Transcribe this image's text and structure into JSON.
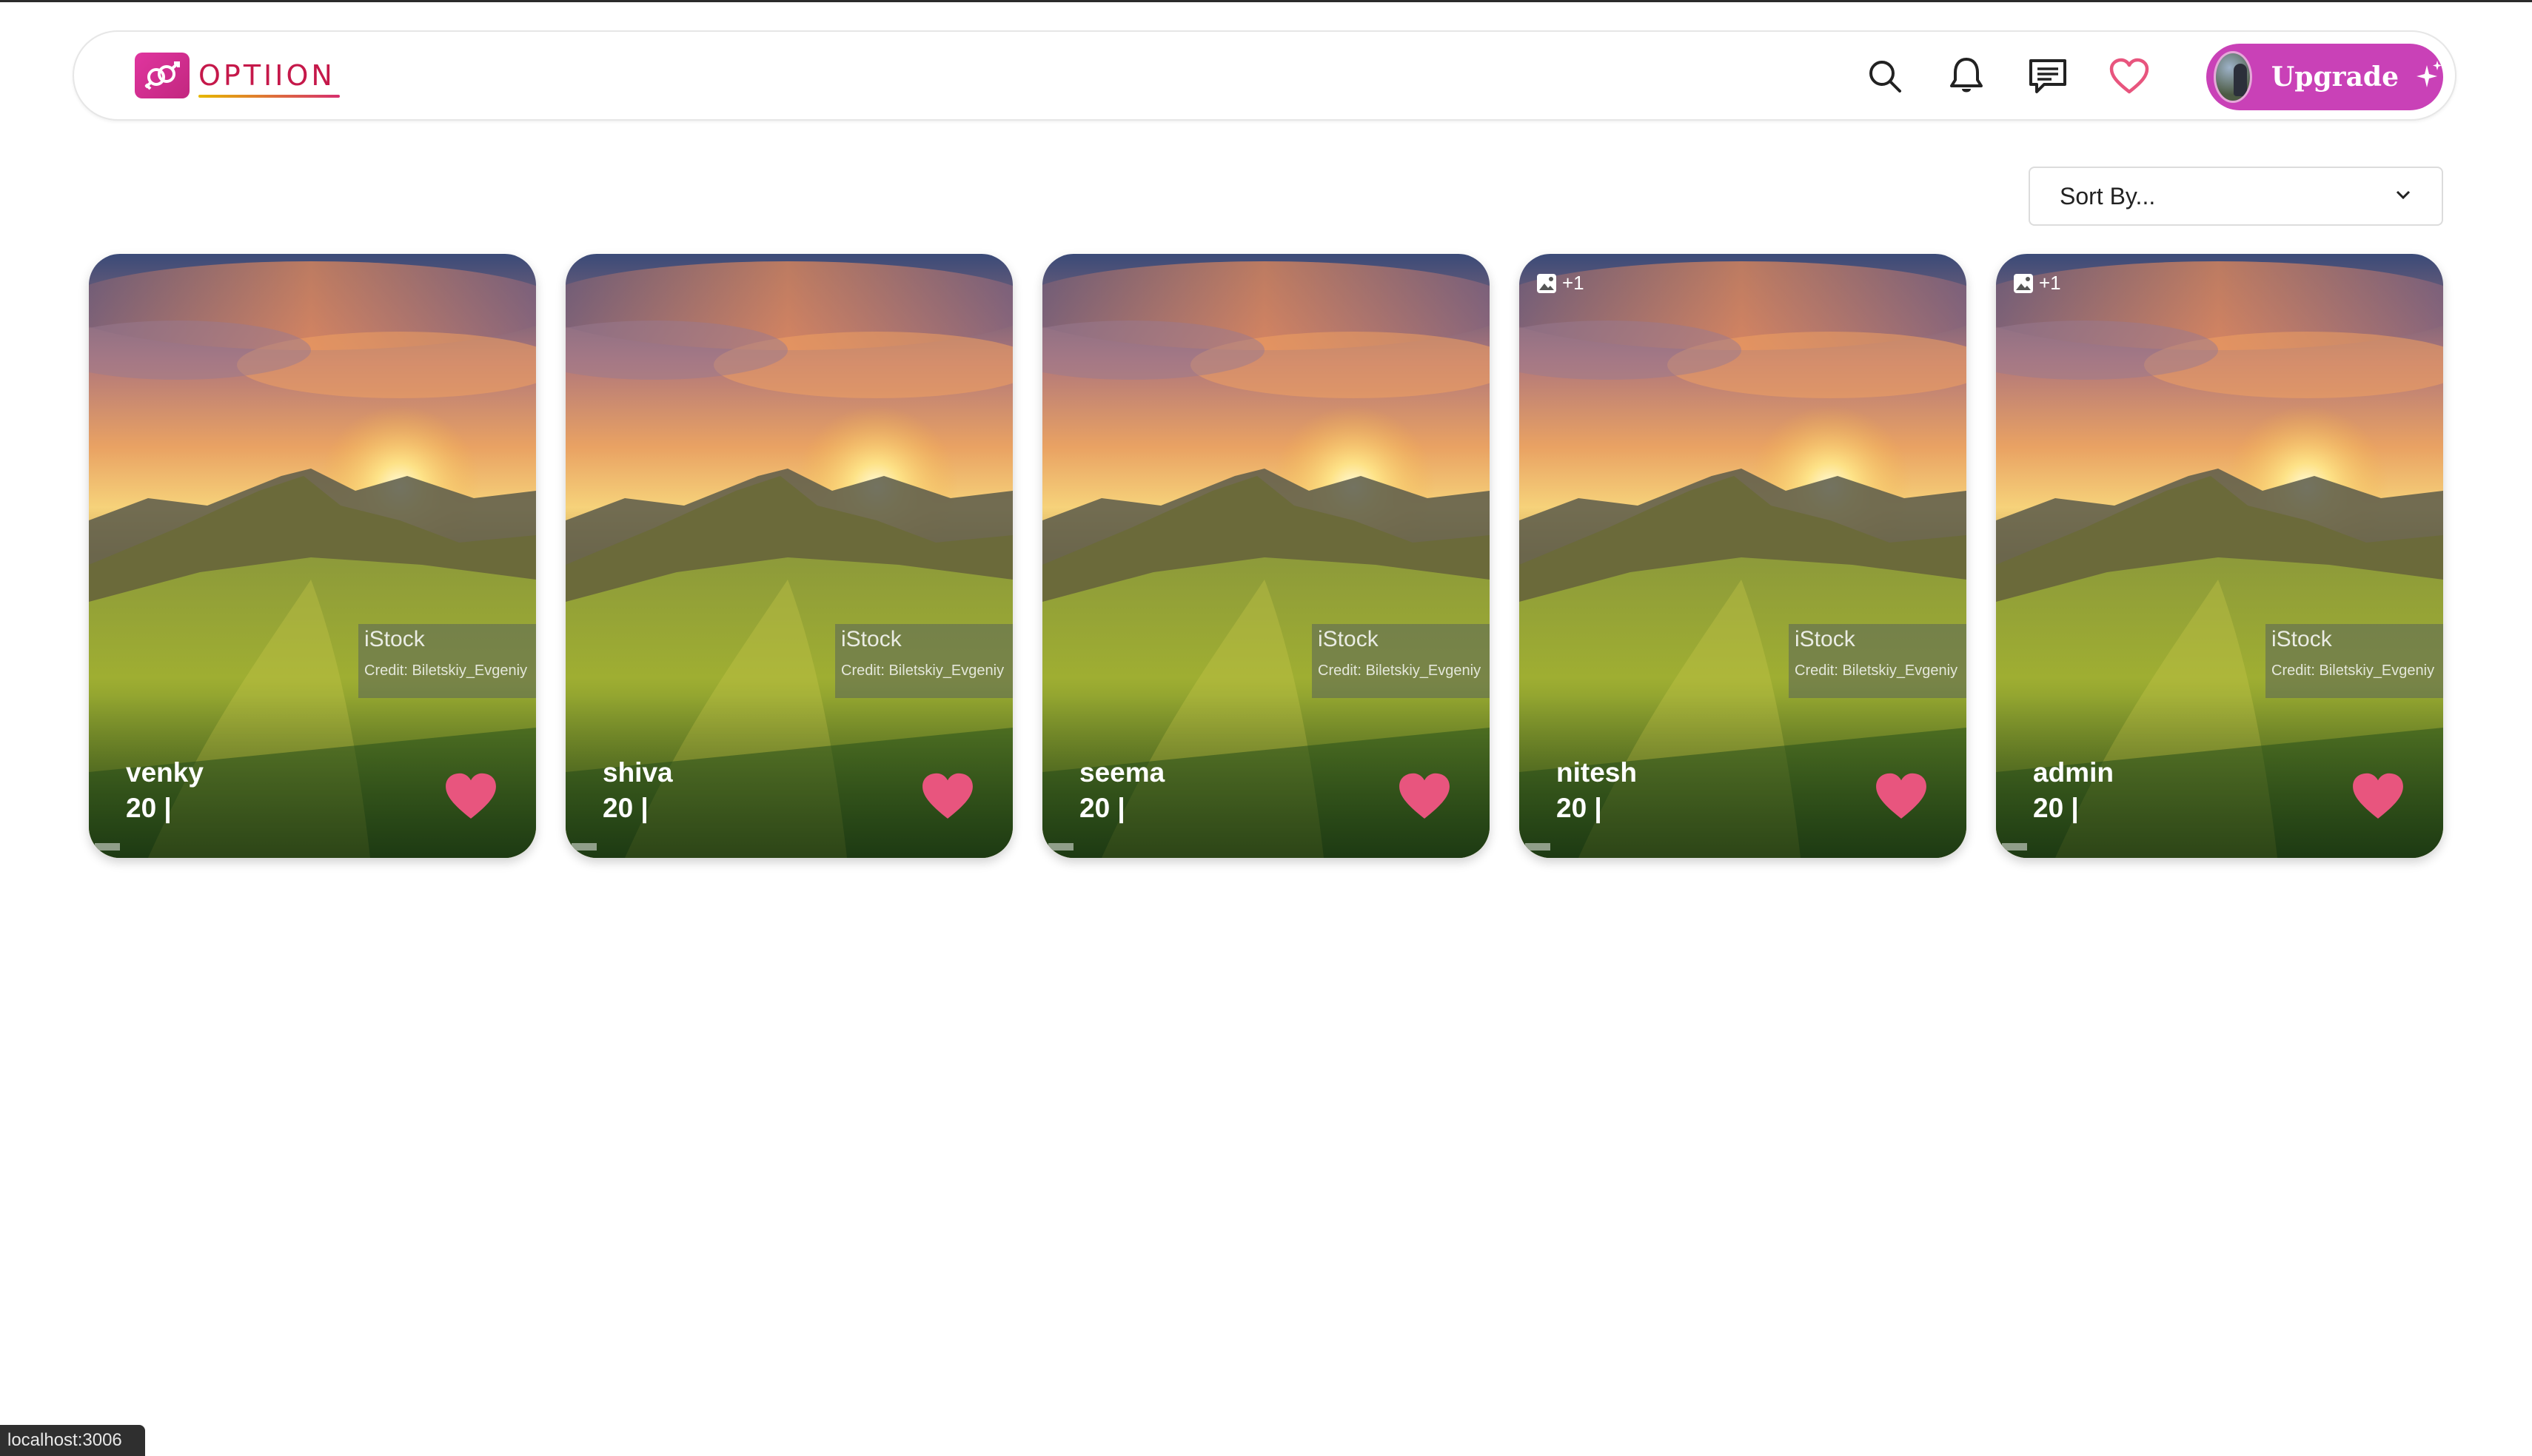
{
  "header": {
    "logo_text": "OPTIION",
    "icons": [
      "search-icon",
      "bell-icon",
      "chat-icon",
      "heart-outline-icon"
    ],
    "upgrade_label": "Upgrade"
  },
  "sort": {
    "label": "Sort By..."
  },
  "profiles": [
    {
      "name": "venky",
      "age": "20 |",
      "photo_badge": ""
    },
    {
      "name": "shiva",
      "age": "20 |",
      "photo_badge": ""
    },
    {
      "name": "seema",
      "age": "20 |",
      "photo_badge": ""
    },
    {
      "name": "nitesh",
      "age": "20 |",
      "photo_badge": "+1"
    },
    {
      "name": "admin",
      "age": "20 |",
      "photo_badge": "+1"
    }
  ],
  "watermark": {
    "brand": "iStock",
    "credit": "Credit: Biletskiy_Evgeniy"
  },
  "status_bar": {
    "url": "localhost:3006"
  },
  "colors": {
    "accent": "#c941b7",
    "heart": "#e8557e",
    "logo": "#c5184a"
  }
}
